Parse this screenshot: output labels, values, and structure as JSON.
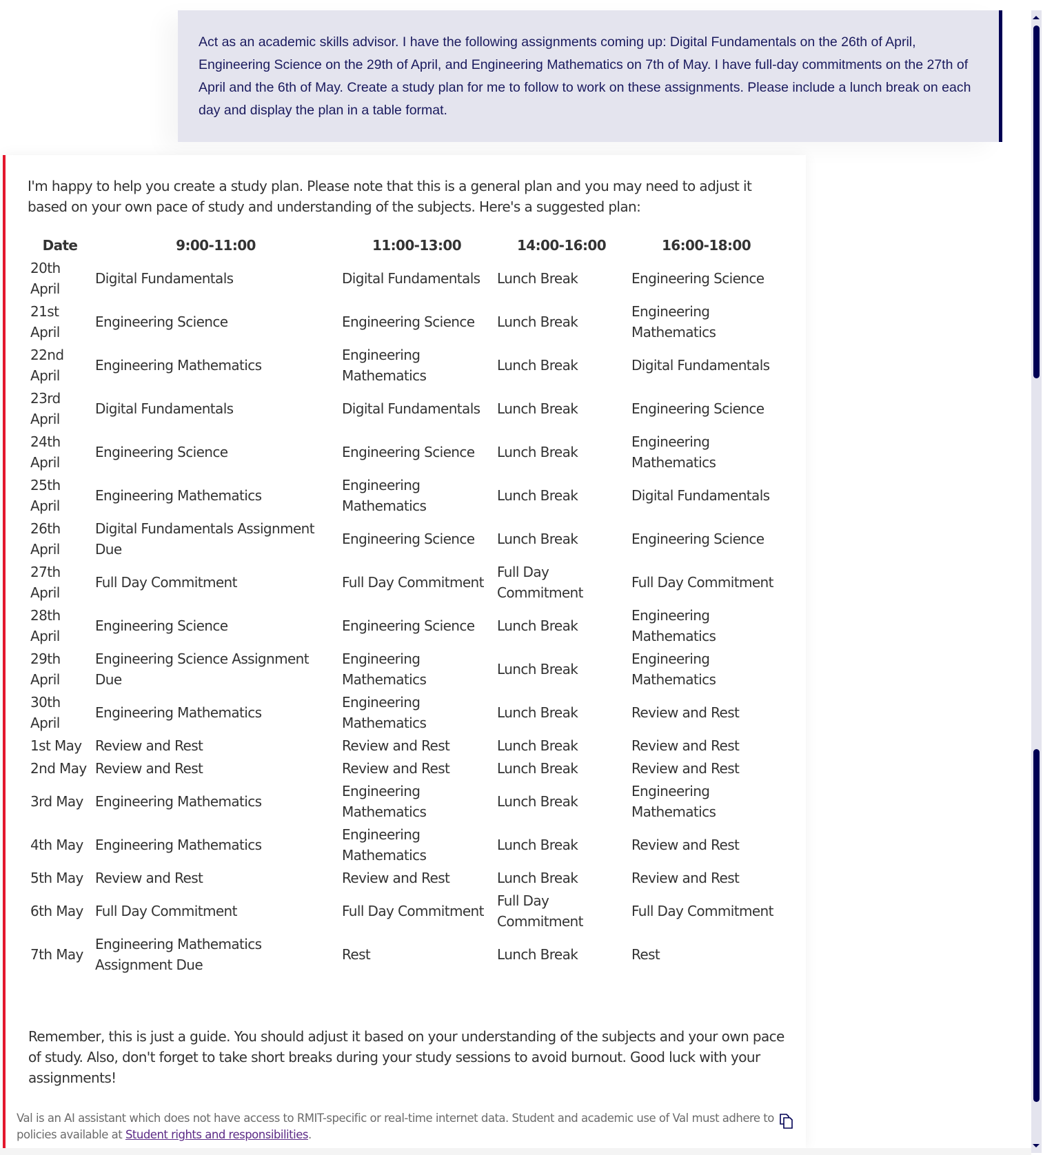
{
  "user_message": {
    "text": "Act as an academic skills advisor. I have the following assignments coming up: Digital Fundamentals on the 26th of April, Engineering Science on the 29th of April, and Engineering Mathematics on 7th of May. I have full-day commitments on the 27th of April and the 6th of May. Create a study plan for me to follow to work on these assignments. Please include a lunch break on each day and display the plan in a table format."
  },
  "assistant_message": {
    "intro": "I'm happy to help you create a study plan. Please note that this is a general plan and you may need to adjust it based on your own pace of study and understanding of the subjects. Here's a suggested plan:",
    "table": {
      "headers": [
        "Date",
        "9:00-11:00",
        "11:00-13:00",
        "14:00-16:00",
        "16:00-18:00"
      ],
      "rows": [
        [
          "20th April",
          "Digital Fundamentals",
          "Digital Fundamentals",
          "Lunch Break",
          "Engineering Science"
        ],
        [
          "21st April",
          "Engineering Science",
          "Engineering Science",
          "Lunch Break",
          "Engineering Mathematics"
        ],
        [
          "22nd April",
          "Engineering Mathematics",
          "Engineering Mathematics",
          "Lunch Break",
          "Digital Fundamentals"
        ],
        [
          "23rd April",
          "Digital Fundamentals",
          "Digital Fundamentals",
          "Lunch Break",
          "Engineering Science"
        ],
        [
          "24th April",
          "Engineering Science",
          "Engineering Science",
          "Lunch Break",
          "Engineering Mathematics"
        ],
        [
          "25th April",
          "Engineering Mathematics",
          "Engineering Mathematics",
          "Lunch Break",
          "Digital Fundamentals"
        ],
        [
          "26th April",
          "Digital Fundamentals Assignment Due",
          "Engineering Science",
          "Lunch Break",
          "Engineering Science"
        ],
        [
          "27th April",
          "Full Day Commitment",
          "Full Day Commitment",
          "Full Day Commitment",
          "Full Day Commitment"
        ],
        [
          "28th April",
          "Engineering Science",
          "Engineering Science",
          "Lunch Break",
          "Engineering Mathematics"
        ],
        [
          "29th April",
          "Engineering Science Assignment Due",
          "Engineering Mathematics",
          "Lunch Break",
          "Engineering Mathematics"
        ],
        [
          "30th April",
          "Engineering Mathematics",
          "Engineering Mathematics",
          "Lunch Break",
          "Review and Rest"
        ],
        [
          "1st May",
          "Review and Rest",
          "Review and Rest",
          "Lunch Break",
          "Review and Rest"
        ],
        [
          "2nd May",
          "Review and Rest",
          "Review and Rest",
          "Lunch Break",
          "Review and Rest"
        ],
        [
          "3rd May",
          "Engineering Mathematics",
          "Engineering Mathematics",
          "Lunch Break",
          "Engineering Mathematics"
        ],
        [
          "4th May",
          "Engineering Mathematics",
          "Engineering Mathematics",
          "Lunch Break",
          "Review and Rest"
        ],
        [
          "5th May",
          "Review and Rest",
          "Review and Rest",
          "Lunch Break",
          "Review and Rest"
        ],
        [
          "6th May",
          "Full Day Commitment",
          "Full Day Commitment",
          "Full Day Commitment",
          "Full Day Commitment"
        ],
        [
          "7th May",
          "Engineering Mathematics Assignment Due",
          "Rest",
          "Lunch Break",
          "Rest"
        ]
      ]
    },
    "outro": "Remember, this is just a guide. You should adjust it based on your understanding of the subjects and your own pace of study. Also, don't forget to take short breaks during your study sessions to avoid burnout. Good luck with your assignments!"
  },
  "disclaimer": {
    "text": "Val is an AI assistant which does not have access to RMIT-specific or real-time internet data. Student and academic use of Val must adhere to policies available at ",
    "link_label": "Student rights and responsibilities",
    "suffix": "."
  },
  "icons": {
    "copy": "copy-icon"
  },
  "colors": {
    "user_bubble_bg": "#e4e4ee",
    "user_accent": "#000054",
    "assistant_accent": "#e3182d",
    "link": "#5b2a86"
  }
}
